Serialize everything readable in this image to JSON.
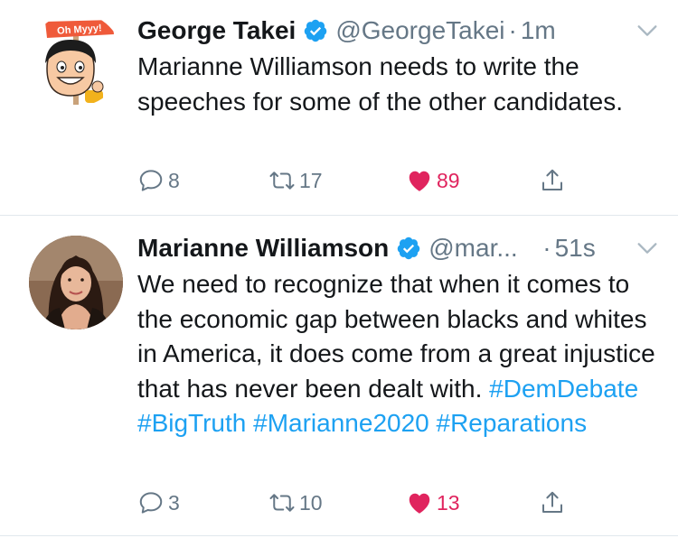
{
  "tweets": [
    {
      "name": "George Takei",
      "handle": "@GeorgeTakei",
      "time": "1m",
      "text": "Marianne Williamson needs to write the speeches for some of the other candidates.",
      "avatar_sign": "Oh Myyy!",
      "replies": "8",
      "retweets": "17",
      "likes": "89",
      "liked": true
    },
    {
      "name": "Marianne Williamson",
      "handle": "@mar...",
      "time": "51s",
      "text": "We need to recognize that when it comes to the economic gap between blacks and whites in America, it does come from a great injustice that has never been dealt with.",
      "hashtags": [
        "#DemDebate",
        "#BigTruth",
        "#Marianne2020",
        "#Reparations"
      ],
      "replies": "3",
      "retweets": "10",
      "likes": "13",
      "liked": true
    }
  ],
  "colors": {
    "link": "#1da1f2",
    "like": "#e0245e",
    "secondary_text": "#657786",
    "divider": "#e1e8ed"
  },
  "icons": {
    "verified": "verified-badge-icon",
    "chevron": "chevron-down-icon",
    "reply": "reply-icon",
    "retweet": "retweet-icon",
    "like": "heart-icon",
    "share": "share-icon"
  }
}
